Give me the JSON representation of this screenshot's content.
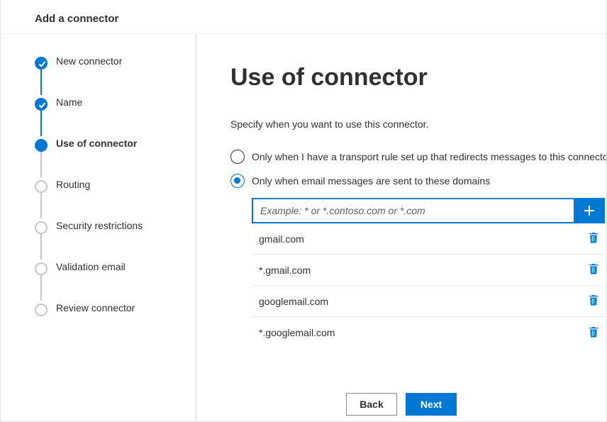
{
  "header": {
    "title": "Add a connector"
  },
  "steps": [
    {
      "label": "New connector",
      "state": "done"
    },
    {
      "label": "Name",
      "state": "done"
    },
    {
      "label": "Use of connector",
      "state": "current"
    },
    {
      "label": "Routing",
      "state": "pending"
    },
    {
      "label": "Security restrictions",
      "state": "pending"
    },
    {
      "label": "Validation email",
      "state": "pending"
    },
    {
      "label": "Review connector",
      "state": "pending"
    }
  ],
  "main": {
    "title": "Use of connector",
    "description": "Specify when you want to use this connector.",
    "options": {
      "transport_rule": {
        "label": "Only when I have a transport rule set up that redirects messages to this connector",
        "selected": false
      },
      "domains": {
        "label": "Only when email messages are sent to these domains",
        "selected": true,
        "input_placeholder": "Example: * or *.contoso.com or *.com",
        "input_value": "",
        "list": [
          "gmail.com",
          "*.gmail.com",
          "googlemail.com",
          "*.googlemail.com"
        ]
      }
    }
  },
  "footer": {
    "back": "Back",
    "next": "Next"
  }
}
